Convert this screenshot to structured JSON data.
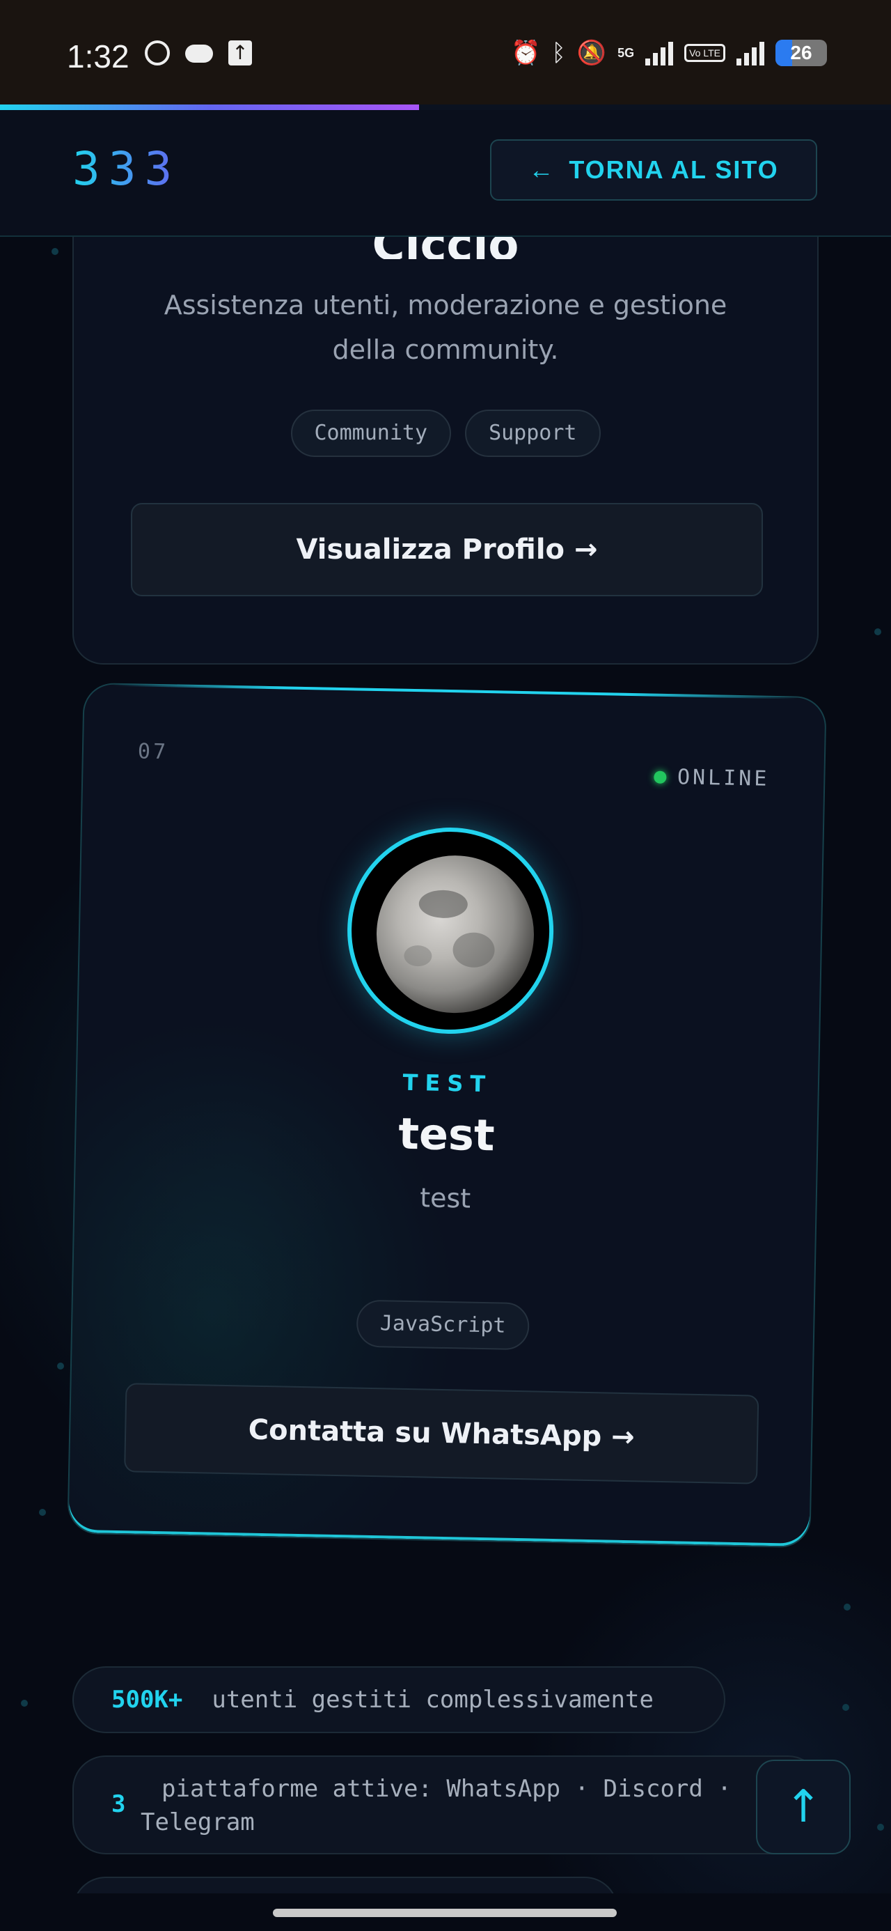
{
  "status_bar": {
    "time": "1:32",
    "network": "5G",
    "volte": "Vo LTE",
    "battery": "26",
    "icons": [
      "whatsapp-icon",
      "cloud-icon",
      "upload-icon",
      "alarm-icon",
      "bluetooth-icon",
      "mute-icon",
      "signal-icon",
      "battery-icon"
    ]
  },
  "page_progress": 0.47,
  "header": {
    "logo": "333",
    "back_button": "TORNA AL SITO",
    "back_icon": "arrow-left-icon"
  },
  "card_previous": {
    "name": "Ciccio",
    "description": "Assistenza utenti, moderazione e gestione della community.",
    "tags": [
      "Community",
      "Support"
    ],
    "button": "Visualizza Profilo →"
  },
  "card_current": {
    "number": "07",
    "status": "ONLINE",
    "role": "TEST",
    "name": "test",
    "subtitle": "test",
    "tags": [
      "JavaScript"
    ],
    "button": "Contatta su WhatsApp →"
  },
  "stats": [
    {
      "value": "500K+",
      "label": "utenti gestiti complessivamente"
    },
    {
      "value": "3",
      "label": "piattaforme attive: WhatsApp · Discord · Telegram"
    }
  ],
  "to_top": "↑",
  "colors": {
    "accent": "#22d3ee",
    "online": "#22c55e",
    "background": "#060a14"
  }
}
